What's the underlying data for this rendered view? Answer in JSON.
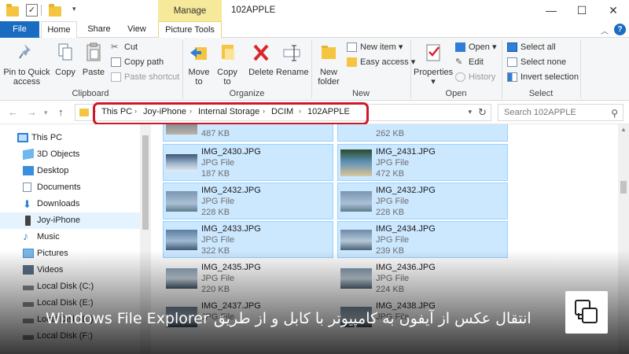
{
  "window": {
    "context_tab": "Manage",
    "title": "102APPLE"
  },
  "tabs": [
    {
      "label": "File"
    },
    {
      "label": "Home"
    },
    {
      "label": "Share"
    },
    {
      "label": "View"
    },
    {
      "label": "Picture Tools"
    }
  ],
  "ribbon": {
    "clipboard": {
      "pin": "Pin to Quick access",
      "copy": "Copy",
      "paste": "Paste",
      "cut": "Cut",
      "copy_path": "Copy path",
      "paste_shortcut": "Paste shortcut",
      "label": "Clipboard"
    },
    "organize": {
      "move_to": "Move to",
      "copy_to": "Copy to",
      "delete": "Delete",
      "rename": "Rename",
      "label": "Organize"
    },
    "new": {
      "new_folder": "New folder",
      "new_item": "New item",
      "easy_access": "Easy access",
      "label": "New"
    },
    "open": {
      "properties": "Properties",
      "open": "Open",
      "edit": "Edit",
      "history": "History",
      "label": "Open"
    },
    "select": {
      "select_all": "Select all",
      "select_none": "Select none",
      "invert": "Invert selection",
      "label": "Select"
    }
  },
  "address": {
    "crumbs": [
      "This PC",
      "Joy-iPhone",
      "Internal Storage",
      "DCIM",
      "102APPLE"
    ],
    "search_placeholder": "Search 102APPLE"
  },
  "nav": [
    {
      "label": "This PC",
      "icon": "pc-icon"
    },
    {
      "label": "3D Objects",
      "icon": "cube-icon"
    },
    {
      "label": "Desktop",
      "icon": "desktop-icon"
    },
    {
      "label": "Documents",
      "icon": "documents-icon"
    },
    {
      "label": "Downloads",
      "icon": "download-icon"
    },
    {
      "label": "Joy-iPhone",
      "icon": "phone-icon",
      "selected": true
    },
    {
      "label": "Music",
      "icon": "music-icon"
    },
    {
      "label": "Pictures",
      "icon": "pictures-icon"
    },
    {
      "label": "Videos",
      "icon": "videos-icon"
    },
    {
      "label": "Local Disk (C:)",
      "icon": "disk-icon"
    },
    {
      "label": "Local Disk (E:)",
      "icon": "disk-icon"
    },
    {
      "label": "Local Disk (E:)",
      "icon": "disk-icon"
    },
    {
      "label": "Local Disk (F:)",
      "icon": "disk-icon"
    }
  ],
  "files": {
    "partial": [
      {
        "size": "487 KB"
      },
      {
        "size": "262 KB"
      }
    ],
    "items": [
      {
        "name": "IMG_2430.JPG",
        "type": "JPG File",
        "size": "187 KB"
      },
      {
        "name": "IMG_2431.JPG",
        "type": "JPG File",
        "size": "472 KB"
      },
      {
        "name": "IMG_2432.JPG",
        "type": "JPG File",
        "size": "228 KB"
      },
      {
        "name": "IMG_2432.JPG",
        "type": "JPG File",
        "size": "228 KB"
      },
      {
        "name": "IMG_2433.JPG",
        "type": "JPG File",
        "size": "322 KB"
      },
      {
        "name": "IMG_2434.JPG",
        "type": "JPG File",
        "size": "239 KB"
      },
      {
        "name": "IMG_2435.JPG",
        "type": "JPG File",
        "size": "220 KB"
      },
      {
        "name": "IMG_2436.JPG",
        "type": "JPG File",
        "size": "224 KB"
      },
      {
        "name": "IMG_2437.JPG",
        "type": "JPG File",
        "size": ""
      },
      {
        "name": "IMG_2438.JPG",
        "type": "JPG File",
        "size": ""
      }
    ]
  },
  "caption": "انتقال عکس از آیفون به کامپیوتر با کابل و از طریق Windows File Explorer",
  "colors": {
    "accent": "#1a6cc0",
    "selection_fill": "#cce8ff",
    "selection_border": "#99d1ff",
    "context_tab": "#f7e99a",
    "highlight_box": "#d0182b"
  }
}
